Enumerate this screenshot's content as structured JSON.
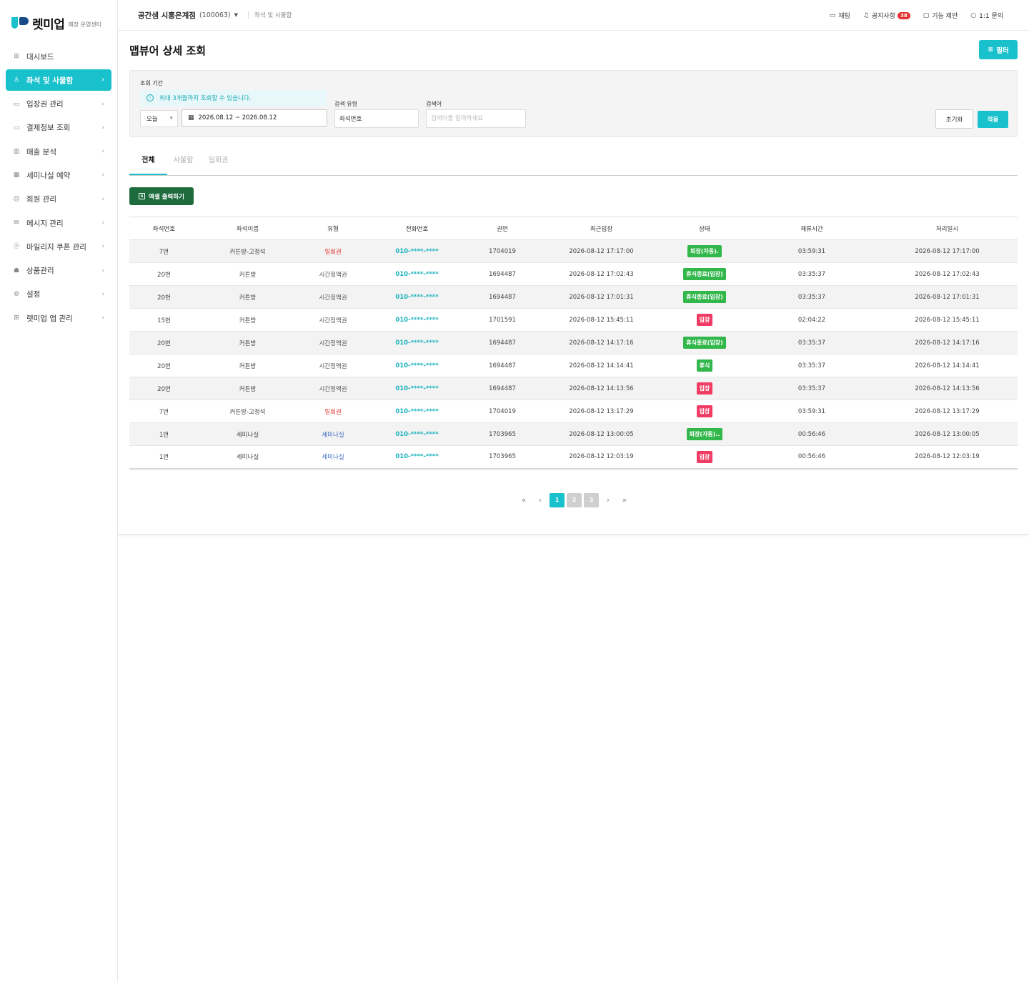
{
  "brand": {
    "name": "렛미업",
    "sub": "매장 운영센터"
  },
  "sidebar": {
    "items": [
      {
        "icon": "grid-icon",
        "label": "대시보드",
        "active": false,
        "chevron": false
      },
      {
        "icon": "seat-icon",
        "label": "좌석 및 사물함",
        "active": true,
        "chevron": true
      },
      {
        "icon": "ticket-icon",
        "label": "입장권 관리",
        "active": false,
        "chevron": true
      },
      {
        "icon": "card-icon",
        "label": "결제정보 조회",
        "active": false,
        "chevron": true
      },
      {
        "icon": "chart-icon",
        "label": "매출 분석",
        "active": false,
        "chevron": true
      },
      {
        "icon": "calendar-icon",
        "label": "세미나실 예약",
        "active": false,
        "chevron": true
      },
      {
        "icon": "users-icon",
        "label": "회원 관리",
        "active": false,
        "chevron": true
      },
      {
        "icon": "mail-icon",
        "label": "메시지 관리",
        "active": false,
        "chevron": true
      },
      {
        "icon": "coin-icon",
        "label": "마일리지 쿠폰 관리",
        "active": false,
        "chevron": true
      },
      {
        "icon": "bag-icon",
        "label": "상품관리",
        "active": false,
        "chevron": true
      },
      {
        "icon": "gear-icon",
        "label": "설정",
        "active": false,
        "chevron": true
      },
      {
        "icon": "apps-icon",
        "label": "렛미업 앱 관리",
        "active": false,
        "chevron": true
      }
    ]
  },
  "topbar": {
    "store_name": "공간샘 시흥은계점",
    "store_code": "(100063)",
    "breadcrumb": "좌석 및 사물함",
    "links": {
      "chat": "채팅",
      "notice": "공지사항",
      "notice_count": "38",
      "suggest": "기능 제안",
      "inquiry": "1:1 문의"
    }
  },
  "page": {
    "title": "맵뷰어 상세 조회",
    "filter_button": "필터"
  },
  "filter": {
    "period_label": "조회 기간",
    "notice": "최대 3개월까지 조회할 수 있습니다.",
    "period_value": "오늘",
    "date_range": "2026.08.12 ~ 2026.08.12",
    "search_type_label": "검색 유형",
    "search_type_value": "좌석번호",
    "search_label": "검색어",
    "search_placeholder": "검색어를 입력하세요",
    "reset": "초기화",
    "apply": "적용"
  },
  "tabs": [
    {
      "label": "전체",
      "active": true
    },
    {
      "label": "사물함",
      "active": false
    },
    {
      "label": "일회권",
      "active": false
    }
  ],
  "excel_button": "엑셀 출력하기",
  "table": {
    "columns": [
      "좌석번호",
      "좌석이름",
      "유형",
      "전화번호",
      "권번",
      "최근입장",
      "상태",
      "체류시간",
      "처리일시"
    ],
    "rows": [
      {
        "seat": "7번",
        "name": "커튼방-고정석",
        "type": "일회권",
        "type_style": "red",
        "phone": "010-****-****",
        "ticket": "1704019",
        "recent": "2026-08-12 17:17:00",
        "status": "퇴장(자동).",
        "status_style": "green",
        "stay": "03:59:31",
        "processed": "2026-08-12 17:17:00"
      },
      {
        "seat": "20번",
        "name": "커튼방",
        "type": "시간정액권",
        "type_style": "gray",
        "phone": "010-****-****",
        "ticket": "1694487",
        "recent": "2026-08-12 17:02:43",
        "status": "휴식종료(입장)",
        "status_style": "green",
        "stay": "03:35:37",
        "processed": "2026-08-12 17:02:43"
      },
      {
        "seat": "20번",
        "name": "커튼방",
        "type": "시간정액권",
        "type_style": "gray",
        "phone": "010-****-****",
        "ticket": "1694487",
        "recent": "2026-08-12 17:01:31",
        "status": "휴식종료(입장)",
        "status_style": "green",
        "stay": "03:35:37",
        "processed": "2026-08-12 17:01:31"
      },
      {
        "seat": "15번",
        "name": "커튼방",
        "type": "시간정액권",
        "type_style": "gray",
        "phone": "010-****-****",
        "ticket": "1701591",
        "recent": "2026-08-12 15:45:11",
        "status": "입장",
        "status_style": "red",
        "stay": "02:04:22",
        "processed": "2026-08-12 15:45:11"
      },
      {
        "seat": "20번",
        "name": "커튼방",
        "type": "시간정액권",
        "type_style": "gray",
        "phone": "010-****-****",
        "ticket": "1694487",
        "recent": "2026-08-12 14:17:16",
        "status": "휴식종료(입장)",
        "status_style": "green",
        "stay": "03:35:37",
        "processed": "2026-08-12 14:17:16"
      },
      {
        "seat": "20번",
        "name": "커튼방",
        "type": "시간정액권",
        "type_style": "gray",
        "phone": "010-****-****",
        "ticket": "1694487",
        "recent": "2026-08-12 14:14:41",
        "status": "휴식",
        "status_style": "green",
        "stay": "03:35:37",
        "processed": "2026-08-12 14:14:41"
      },
      {
        "seat": "20번",
        "name": "커튼방",
        "type": "시간정액권",
        "type_style": "gray",
        "phone": "010-****-****",
        "ticket": "1694487",
        "recent": "2026-08-12 14:13:56",
        "status": "입장",
        "status_style": "red",
        "stay": "03:35:37",
        "processed": "2026-08-12 14:13:56"
      },
      {
        "seat": "7번",
        "name": "커튼방-고정석",
        "type": "일회권",
        "type_style": "red",
        "phone": "010-****-****",
        "ticket": "1704019",
        "recent": "2026-08-12 13:17:29",
        "status": "입장",
        "status_style": "red",
        "stay": "03:59:31",
        "processed": "2026-08-12 13:17:29"
      },
      {
        "seat": "1번",
        "name": "세미나실",
        "type": "세미나실",
        "type_style": "blue",
        "phone": "010-****-****",
        "ticket": "1703965",
        "recent": "2026-08-12 13:00:05",
        "status": "퇴장(자동)..",
        "status_style": "green",
        "stay": "00:56:46",
        "processed": "2026-08-12 13:00:05"
      },
      {
        "seat": "1번",
        "name": "세미나실",
        "type": "세미나실",
        "type_style": "blue",
        "phone": "010-****-****",
        "ticket": "1703965",
        "recent": "2026-08-12 12:03:19",
        "status": "입장",
        "status_style": "red",
        "stay": "00:56:46",
        "processed": "2026-08-12 12:03:19"
      }
    ]
  },
  "pagination": {
    "pages": [
      "1",
      "2",
      "3"
    ],
    "current": "1"
  },
  "colors": {
    "accent": "#19c1cc",
    "excel": "#1e6b3e",
    "status_green": "#31b74a",
    "status_red": "#f03c62",
    "badge": "#e5302f"
  }
}
